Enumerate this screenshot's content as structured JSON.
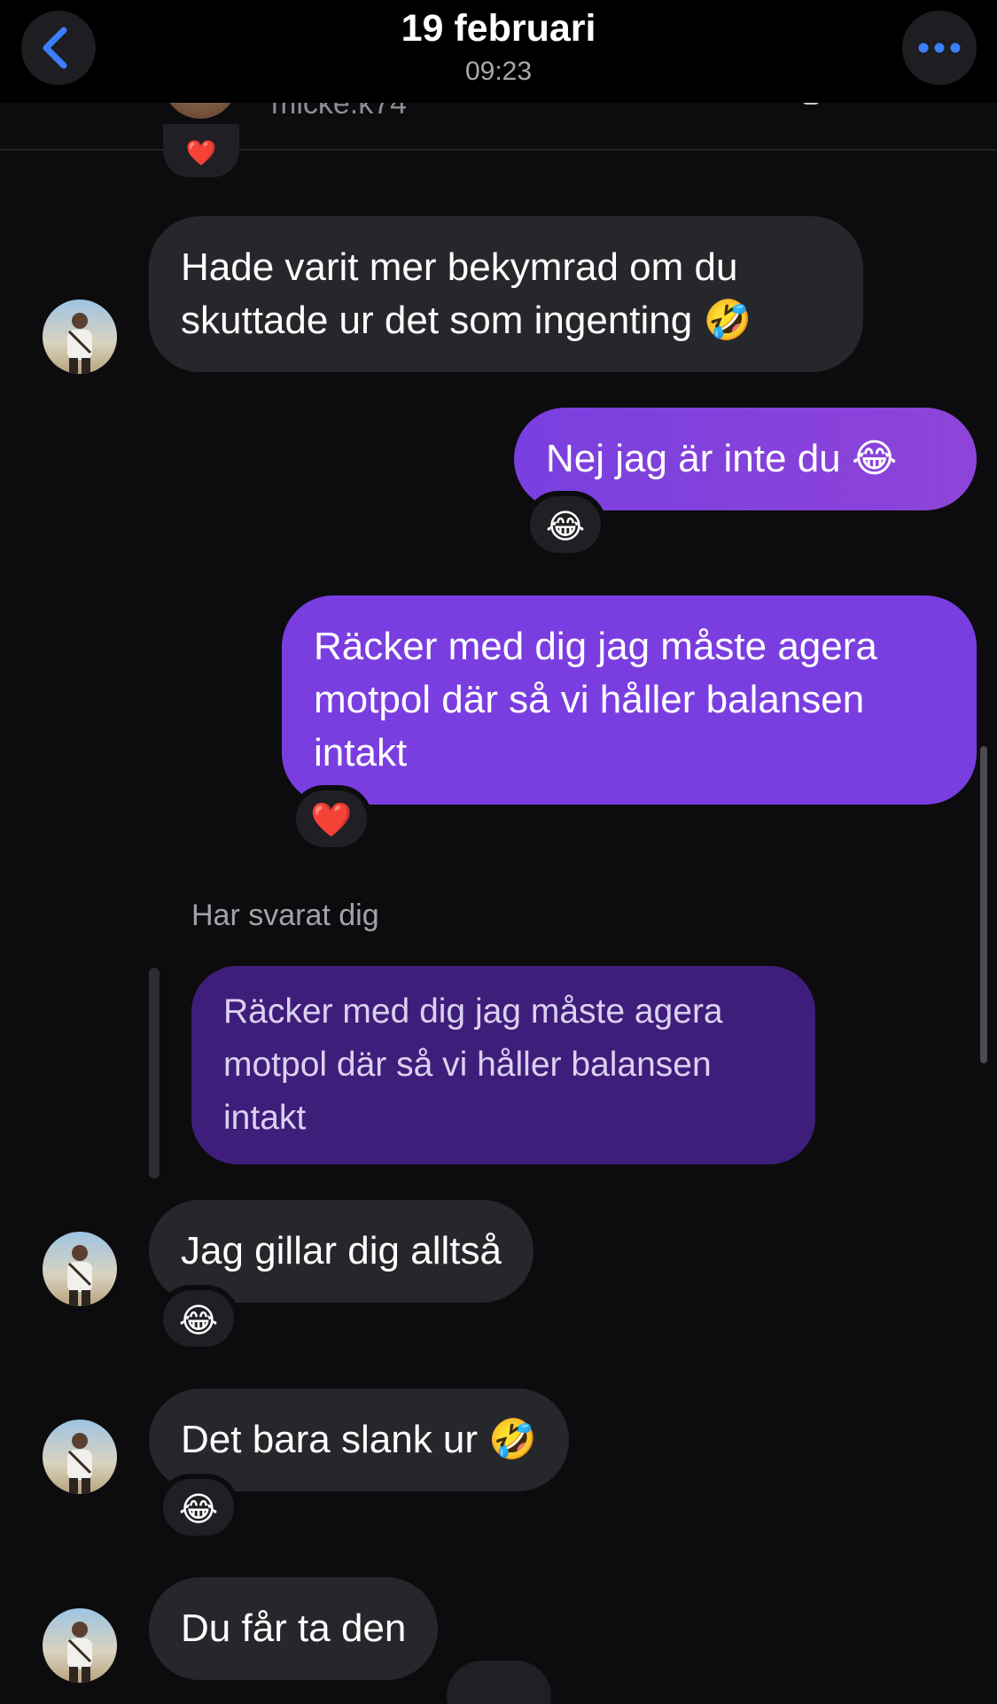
{
  "header": {
    "date": "19 februari",
    "time": "09:23",
    "back_icon": "chevron-left-icon",
    "more_icon": "more-horizontal-icon"
  },
  "peek": {
    "username": "micke.k74",
    "reaction": "❤️"
  },
  "messages": [
    {
      "side": "in",
      "text": "Hade varit mer bekymrad om du skuttade ur det som ingenting 🤣",
      "line1": "Hade varit mer bekymrad om du",
      "line2": "skuttade ur det som ingenting 🤣"
    },
    {
      "side": "out",
      "text": "Nej jag är inte du 😂",
      "reaction": "😂"
    },
    {
      "side": "out",
      "text": "Räcker med dig jag måste agera motpol där så vi håller balansen intakt",
      "line1": "Räcker med dig jag måste agera",
      "line2": "motpol där så vi håller balansen",
      "line3": "intakt",
      "reaction": "❤️"
    },
    {
      "side": "in",
      "reply_label": "Har svarat dig",
      "quoted_line1": "Räcker med dig jag måste agera",
      "quoted_line2": "motpol där så vi håller balansen",
      "quoted_line3": "intakt",
      "text": "Jag gillar dig alltså",
      "reaction": "😂"
    },
    {
      "side": "in",
      "text": "Det bara slank ur 🤣",
      "reaction": "😂"
    },
    {
      "side": "in",
      "text": "Du får ta den",
      "reaction": ""
    }
  ],
  "colors": {
    "background": "#0c0c0e",
    "incoming_bubble": "#26272b",
    "outgoing_bubble": "#8040e0",
    "quoted_bubble": "#3e1e7a",
    "accent_icon": "#3d7eff"
  }
}
